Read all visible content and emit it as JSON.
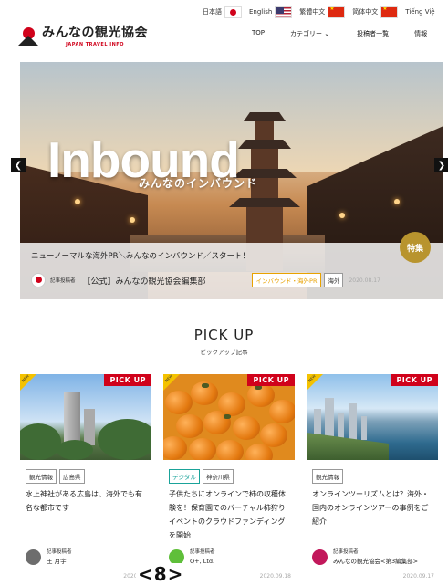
{
  "languages": [
    {
      "label": "日本語",
      "flag": "jp"
    },
    {
      "label": "English",
      "flag": "us"
    },
    {
      "label": "繁體中文",
      "flag": "cn"
    },
    {
      "label": "简体中文",
      "flag": "cn"
    },
    {
      "label": "Tiếng Việ",
      "flag": "vn"
    }
  ],
  "header": {
    "logo_name": "みんなの観光協会",
    "logo_sub": "JAPAN TRAVEL INFO",
    "nav": [
      {
        "label": "TOP"
      },
      {
        "label": "カテゴリー ⌄"
      },
      {
        "label": "投稿者一覧"
      },
      {
        "label": "情報"
      }
    ]
  },
  "hero": {
    "headline": "Inbound",
    "headline_sub": "みんなのインバウンド",
    "title": "ニューノーマルな海外PR＼みんなのインバウンド／スタート！",
    "badge": "特集",
    "author_label": "記事投稿者",
    "author": "【公式】みんなの観光協会編集部",
    "tags": [
      "インバウンド・海外PR",
      "海外"
    ],
    "date": "2020.08.17"
  },
  "pickup": {
    "title": "PICK UP",
    "subtitle": "ピックアップ記事",
    "ribbon": "PICK UP",
    "new_label": "NEW",
    "cards": [
      {
        "tags": [
          "観光情報",
          "広島県"
        ],
        "title": "水上神社がある広島は、海外でも有名な都市です",
        "author_label": "記事投稿者",
        "author": "王 月宇",
        "date": "2020.09.",
        "avatar_color": "#6d6d6d"
      },
      {
        "tags": [
          "デジタル",
          "神奈川県"
        ],
        "title": "子供たちにオンラインで柿の収穫体験を！保育園でのバーチャル柿狩りイベントのクラウドファンディングを開始",
        "author_label": "記事投稿者",
        "author": "Q+, Ltd.",
        "date": "2020.09.18",
        "avatar_color": "#5fbf3a"
      },
      {
        "tags": [
          "観光情報"
        ],
        "title": "オンラインツーリズムとは？海外・国内のオンラインツアーの事例をご紹介",
        "author_label": "記事投稿者",
        "author": "みんなの観光協会<第3編集部>",
        "date": "2020.09.17",
        "avatar_color": "#c2185b"
      }
    ]
  },
  "pager_label": "<8>"
}
